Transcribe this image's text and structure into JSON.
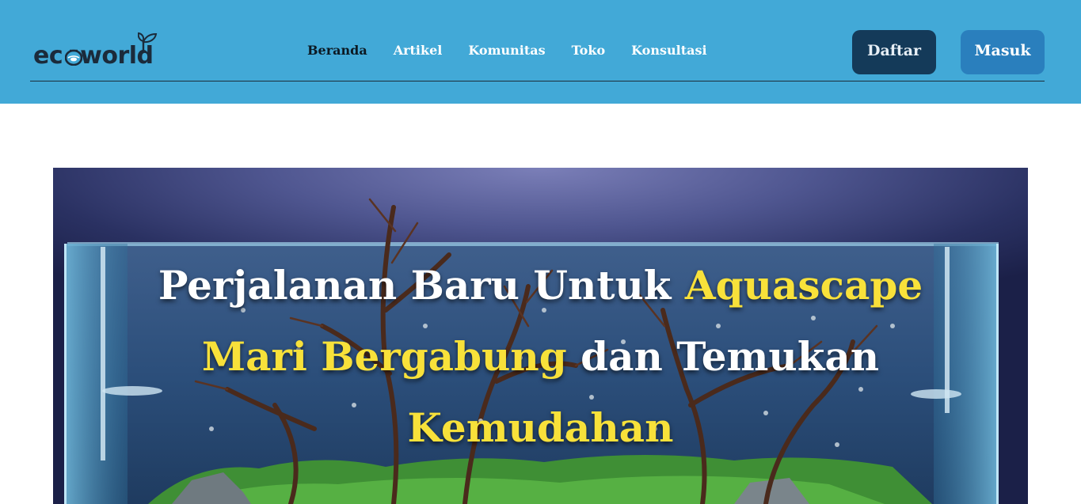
{
  "brand": {
    "logo_text_start": "ec",
    "logo_text_end": "world"
  },
  "nav": {
    "items": [
      {
        "label": "Beranda",
        "active": true
      },
      {
        "label": "Artikel",
        "active": false
      },
      {
        "label": "Komunitas",
        "active": false
      },
      {
        "label": "Toko",
        "active": false
      },
      {
        "label": "Konsultasi",
        "active": false
      }
    ]
  },
  "auth": {
    "register_label": "Daftar",
    "login_label": "Masuk"
  },
  "hero": {
    "line1_white": "Perjalanan Baru Untuk ",
    "line1_yellow": "Aquascape",
    "line2_yellow": "Mari Bergabung",
    "line2_white": " dan Temukan",
    "line3_yellow": "Kemudahan"
  },
  "colors": {
    "navbar": "#42a9d7",
    "register_button": "#143a59",
    "login_button": "#2a7fbd",
    "highlight": "#f8e13a"
  }
}
